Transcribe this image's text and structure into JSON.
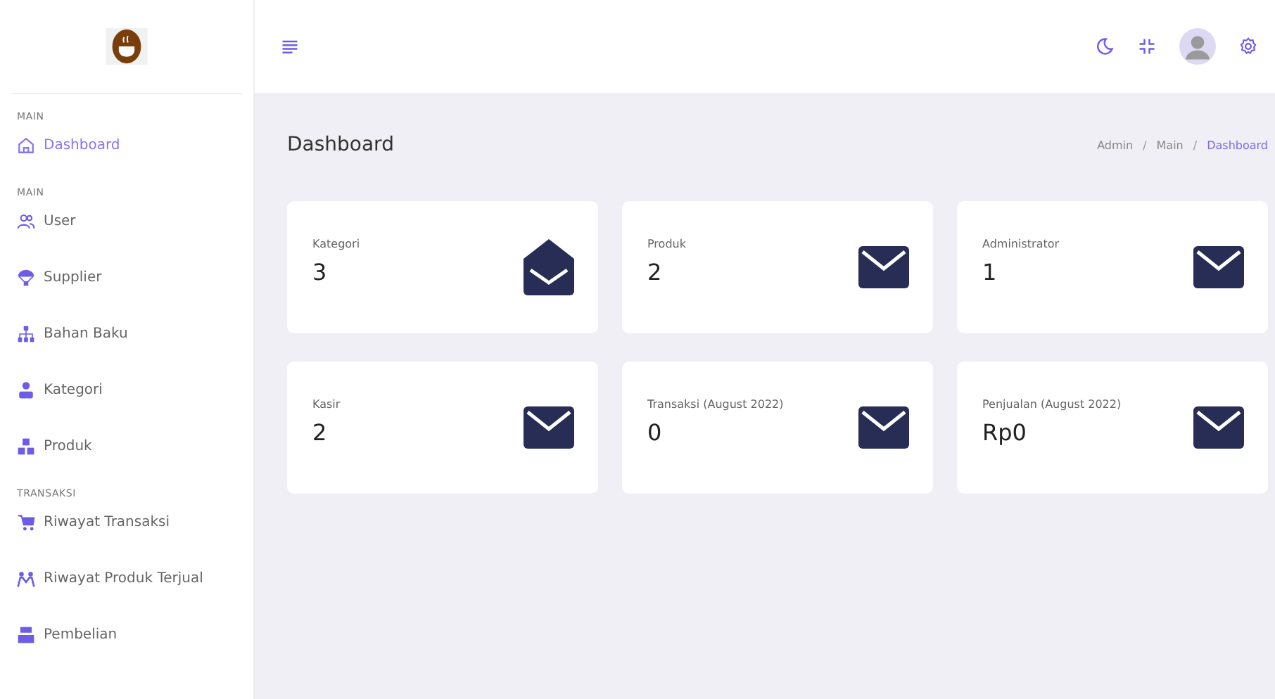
{
  "sidebar": {
    "sections": [
      {
        "heading": "MAIN",
        "items": [
          {
            "label": "Dashboard",
            "selected": true
          }
        ]
      },
      {
        "heading": "MAIN",
        "items": [
          {
            "label": "User",
            "selected": false
          },
          {
            "label": "Supplier",
            "selected": false
          },
          {
            "label": "Bahan Baku",
            "selected": false
          },
          {
            "label": "Kategori",
            "selected": false
          },
          {
            "label": "Produk",
            "selected": false
          }
        ]
      },
      {
        "heading": "TRANSAKSI",
        "items": [
          {
            "label": "Riwayat Transaksi",
            "selected": false
          },
          {
            "label": "Riwayat Produk Terjual",
            "selected": false
          },
          {
            "label": "Pembelian",
            "selected": false
          }
        ]
      }
    ]
  },
  "page": {
    "title": "Dashboard",
    "breadcrumb": [
      {
        "label": "Admin"
      },
      {
        "separator": "/",
        "label": "Main"
      },
      {
        "separator": "/",
        "label": "Dashboard"
      }
    ]
  },
  "stats": [
    {
      "label": "Kategori",
      "value": "3",
      "kind": "open"
    },
    {
      "label": "Produk",
      "value": "2",
      "kind": "closed"
    },
    {
      "label": "Administrator",
      "value": "1",
      "kind": "closed"
    },
    {
      "label": "Kasir",
      "value": "2",
      "kind": "closed"
    },
    {
      "label": "Transaksi (August 2022)",
      "value": "0",
      "kind": "closed"
    },
    {
      "label": "Penjualan (August 2022)",
      "value": "Rp0",
      "kind": "closed"
    }
  ]
}
